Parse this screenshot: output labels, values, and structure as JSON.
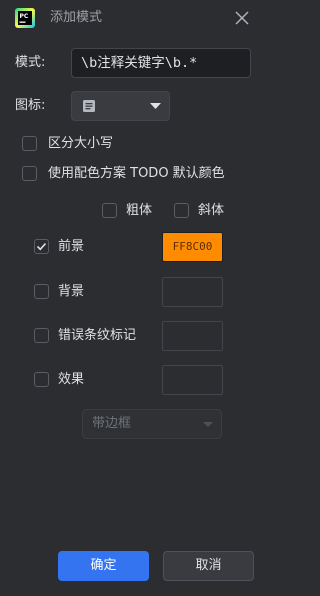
{
  "title": "添加模式",
  "pattern": {
    "label": "模式:",
    "value": "\\b注释关键字\\b.*"
  },
  "icon": {
    "label": "图标:",
    "selected_icon": "note-icon"
  },
  "options": {
    "case_sensitive": {
      "label": "区分大小写",
      "checked": false
    },
    "use_todo_color": {
      "label": "使用配色方案 TODO 默认颜色",
      "checked": false
    },
    "bold": {
      "label": "粗体",
      "checked": false
    },
    "italic": {
      "label": "斜体",
      "checked": false
    }
  },
  "colors": {
    "foreground": {
      "label": "前景",
      "checked": true,
      "value": "FF8C00",
      "color": "#ff8c00"
    },
    "background": {
      "label": "背景",
      "checked": false
    },
    "error_stripe": {
      "label": "错误条纹标记",
      "checked": false
    },
    "effects": {
      "label": "效果",
      "checked": false
    }
  },
  "effect_type": {
    "value": "带边框"
  },
  "buttons": {
    "ok": "确定",
    "cancel": "取消"
  },
  "accent": "#3574f0"
}
